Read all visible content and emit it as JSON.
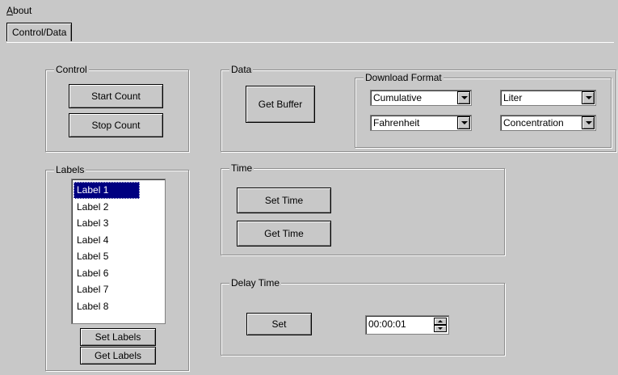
{
  "menu": {
    "about_prefix": "A",
    "about_rest": "bout"
  },
  "tab": {
    "label": "Control/Data"
  },
  "control": {
    "title": "Control",
    "start_label": "Start Count",
    "stop_label": "Stop Count"
  },
  "data": {
    "title": "Data",
    "get_buffer_label": "Get Buffer",
    "download_format": {
      "title": "Download Format",
      "mode": "Cumulative",
      "volume_unit": "Liter",
      "temperature_unit": "Fahrenheit",
      "measure": "Concentration"
    }
  },
  "labels": {
    "title": "Labels",
    "items": [
      "Label 1",
      "Label 2",
      "Label 3",
      "Label 4",
      "Label 5",
      "Label 6",
      "Label 7",
      "Label 8"
    ],
    "selected": "Label 1",
    "set_label": "Set Labels",
    "get_label": "Get Labels"
  },
  "time": {
    "title": "Time",
    "set_label": "Set Time",
    "get_label": "Get Time"
  },
  "delay": {
    "title": "Delay Time",
    "set_label": "Set",
    "value": "00:00:01"
  }
}
